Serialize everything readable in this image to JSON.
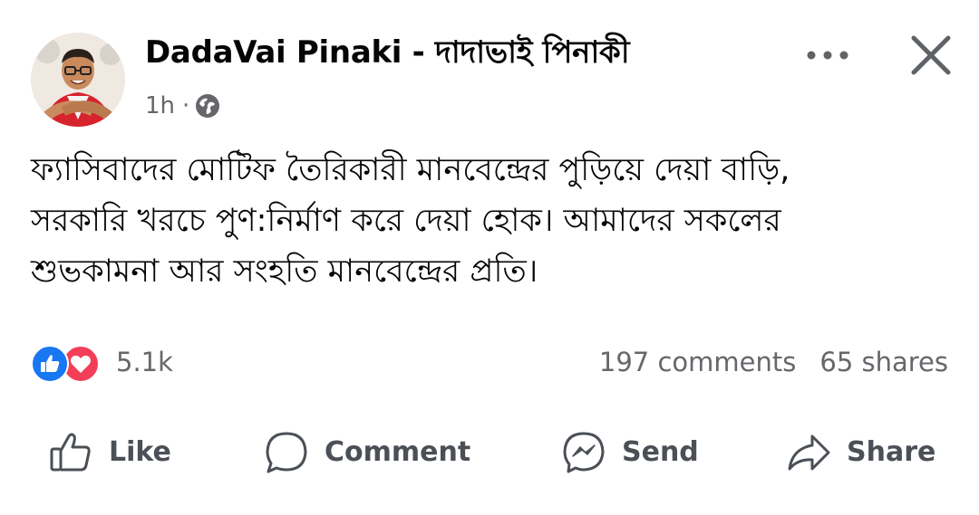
{
  "post": {
    "author_name": "DadaVai Pinaki  - দাদাভাই পিনাকী",
    "time": "1h",
    "separator": "·",
    "privacy_icon": "globe-icon",
    "text_lines": [
      "ফ্যাসিবাদের মোটিফ তৈরিকারী মানবেন্দ্রের পুড়িয়ে দেয়া বাড়ি,",
      "সরকারি খরচে পুণ:নির্মাণ করে দেয়া হোক। আমাদের সকলের",
      "শুভকামনা আর সংহতি মানবেন্দ্রের প্রতি।"
    ],
    "reactions": {
      "count": "5.1k",
      "types": [
        "like",
        "love"
      ]
    },
    "comments": "197 comments",
    "shares": "65 shares"
  },
  "actions": {
    "like": "Like",
    "comment": "Comment",
    "send": "Send",
    "share": "Share"
  },
  "colors": {
    "like_blue": "#1877f2",
    "love_red": "#f33e58",
    "secondary_text": "#65676b",
    "action_text": "#4b4f56"
  }
}
